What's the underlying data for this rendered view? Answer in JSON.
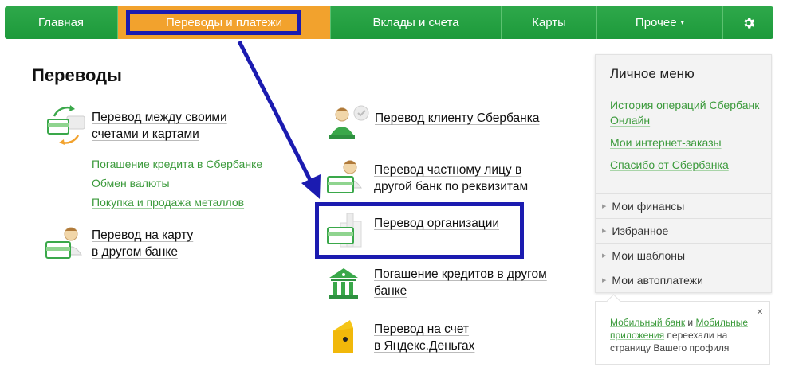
{
  "nav": {
    "items": [
      {
        "label": "Главная"
      },
      {
        "label": "Переводы и платежи"
      },
      {
        "label": "Вклады и счета"
      },
      {
        "label": "Карты"
      },
      {
        "label": "Прочее"
      }
    ],
    "other_chevron": "▾",
    "settings_icon": "gear-icon"
  },
  "page": {
    "title": "Переводы"
  },
  "left": {
    "own_accounts": {
      "line1": "Перевод между своими",
      "line2": "счетами и картами"
    },
    "sub_links": [
      "Погашение кредита в Сбербанке",
      "Обмен валюты",
      "Покупка и продажа металлов"
    ],
    "card_other_bank": {
      "line1": "Перевод на карту",
      "line2": "в другом банке"
    }
  },
  "middle": {
    "sber_client": {
      "line1": "Перевод клиенту Сбербанка"
    },
    "private_person": {
      "line1": "Перевод частному лицу в",
      "line2": "другой банк по реквизитам"
    },
    "organization": {
      "line1": "Перевод организации"
    },
    "loans_other": {
      "line1": "Погашение кредитов в другом",
      "line2": "банке"
    },
    "yandex": {
      "line1": "Перевод на счет",
      "line2": "в Яндекс.Деньгах"
    }
  },
  "panel": {
    "title": "Личное меню",
    "links": [
      "История операций Сбербанк Онлайн",
      "Мои интернет-заказы",
      "Спасибо от Сбербанка"
    ],
    "sections": [
      "Мои финансы",
      "Избранное",
      "Мои шаблоны",
      "Мои автоплатежи"
    ]
  },
  "notice": {
    "link1": "Мобильный банк",
    "and": " и ",
    "link2": "Мобильные приложения",
    "rest": " переехали на страницу Вашего профиля",
    "close": "×"
  },
  "colors": {
    "nav_green": "#1d9a3b",
    "nav_active": "#f2a22d",
    "link_green": "#3b9a3b",
    "highlight_blue": "#1b1bb0"
  }
}
